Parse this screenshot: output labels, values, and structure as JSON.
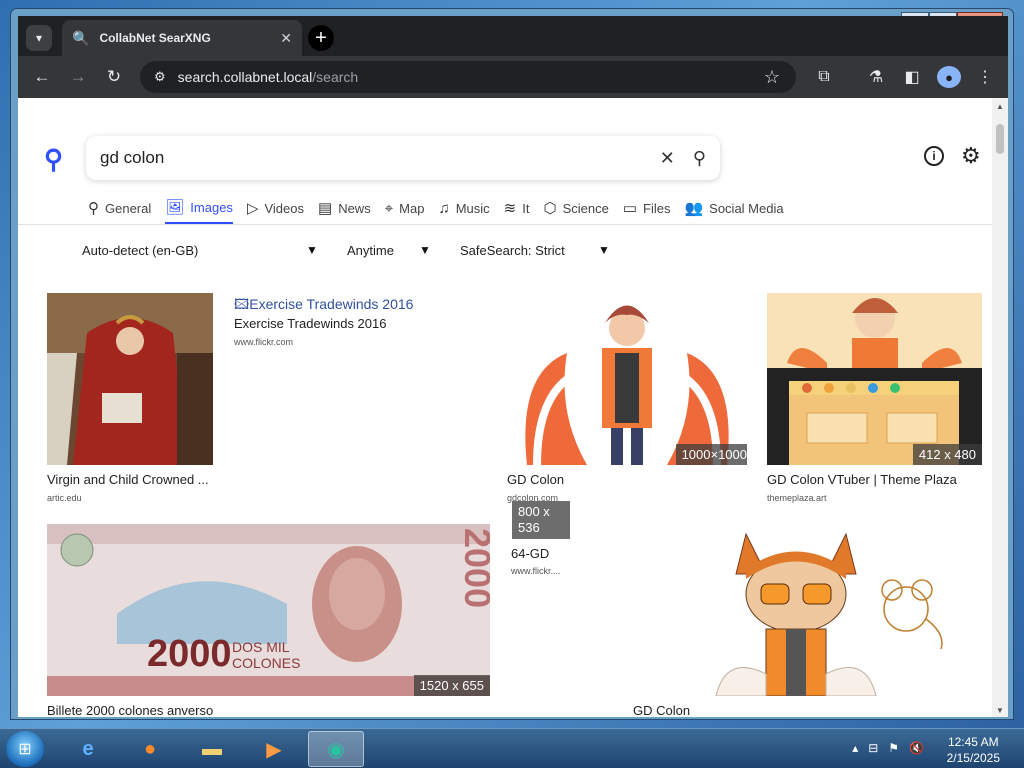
{
  "browser": {
    "tab_title": "CollabNet SearXNG",
    "url_host": "search.collabnet.local",
    "url_path": "/search"
  },
  "search": {
    "query": "gd colon"
  },
  "categories": [
    {
      "label": "General",
      "icon": "search-icon",
      "glyph": "⚲",
      "active": false
    },
    {
      "label": "Images",
      "icon": "image-icon",
      "glyph": "🖼",
      "active": true
    },
    {
      "label": "Videos",
      "icon": "play-icon",
      "glyph": "▷",
      "active": false
    },
    {
      "label": "News",
      "icon": "newspaper-icon",
      "glyph": "▤",
      "active": false
    },
    {
      "label": "Map",
      "icon": "location-icon",
      "glyph": "⌖",
      "active": false
    },
    {
      "label": "Music",
      "icon": "music-icon",
      "glyph": "♫",
      "active": false
    },
    {
      "label": "It",
      "icon": "layers-icon",
      "glyph": "≋",
      "active": false
    },
    {
      "label": "Science",
      "icon": "cube-icon",
      "glyph": "⬡",
      "active": false
    },
    {
      "label": "Files",
      "icon": "files-icon",
      "glyph": "▭",
      "active": false
    },
    {
      "label": "Social Media",
      "icon": "people-icon",
      "glyph": "👥",
      "active": false
    }
  ],
  "filters": {
    "language": "Auto-detect (en-GB)",
    "time": "Anytime",
    "safesearch": "SafeSearch: Strict"
  },
  "results": [
    {
      "title": "Virgin and Child Crowned ...",
      "url": "artic.edu",
      "size": ""
    },
    {
      "title": "Exercise Tradewinds 2016",
      "url": "www.flickr.com",
      "alt": "Exercise Tradewinds 2016",
      "size": ""
    },
    {
      "title": "GD Colon",
      "url": "gdcolon.com",
      "size": "1000×1000"
    },
    {
      "title": "GD Colon VTuber | Theme Plaza",
      "url": "themeplaza.art",
      "size": "412 x 480"
    },
    {
      "title": "Billete 2000 colones anverso",
      "url": "",
      "size": "1520 x 655"
    },
    {
      "title": "64-GD",
      "url": "www.flickr....",
      "alt": "64-GD",
      "size": "800 x 536"
    },
    {
      "title": "GD Colon",
      "url": "",
      "size": ""
    }
  ],
  "taskbar": {
    "time": "12:45 AM",
    "date": "2/15/2025"
  }
}
